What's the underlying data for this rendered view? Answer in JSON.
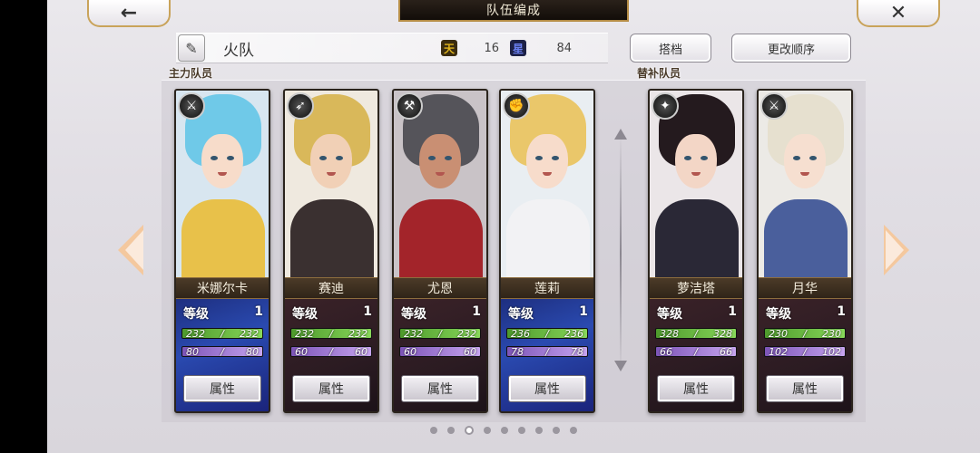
{
  "header": {
    "title": "队伍编成",
    "back_icon": "←",
    "close_icon": "✕"
  },
  "team": {
    "name": "火队",
    "edit_icon": "✎",
    "stat1_icon": "天",
    "stat1_value": "16",
    "stat2_icon": "星",
    "stat2_value": "84"
  },
  "buttons": {
    "partner": "搭档",
    "change_order": "更改顺序"
  },
  "sections": {
    "main": "主力队员",
    "sub": "替补队员"
  },
  "labels": {
    "level": "等级",
    "attr": "属性"
  },
  "cards": [
    {
      "name": "米娜尔卡",
      "level": "1",
      "hp": "232/ 232",
      "hp_cur": "232",
      "hp_max": "232",
      "mp_cur": "80",
      "mp_max": "80",
      "weapon": "⚔",
      "hair": "#6fc9e8",
      "skin": "#f7dcca",
      "cloth": "#e8c14a",
      "bg": "#d8e6f0",
      "stats_bg": "blue"
    },
    {
      "name": "赛迪",
      "level": "1",
      "hp_cur": "232",
      "hp_max": "232",
      "mp_cur": "60",
      "mp_max": "60",
      "weapon": "➶",
      "hair": "#d9b85a",
      "skin": "#f1d0b6",
      "cloth": "#3a3030",
      "bg": "#efe9df",
      "stats_bg": "dark"
    },
    {
      "name": "尤恩",
      "level": "1",
      "hp_cur": "232",
      "hp_max": "232",
      "mp_cur": "60",
      "mp_max": "60",
      "weapon": "⚒",
      "hair": "#55545a",
      "skin": "#c98f73",
      "cloth": "#a3242a",
      "bg": "#c9c3c7",
      "stats_bg": "dark"
    },
    {
      "name": "莲莉",
      "level": "1",
      "hp_cur": "236",
      "hp_max": "236",
      "mp_cur": "78",
      "mp_max": "78",
      "weapon": "✊",
      "hair": "#eac76a",
      "skin": "#f7dccb",
      "cloth": "#f2f2f4",
      "bg": "#e9eef2",
      "stats_bg": "blue"
    },
    {
      "name": "萝洁塔",
      "level": "1",
      "hp_cur": "328",
      "hp_max": "328",
      "mp_cur": "66",
      "mp_max": "66",
      "weapon": "✦",
      "hair": "#241a1e",
      "skin": "#f3d6c6",
      "cloth": "#2a2836",
      "bg": "#ebe6e8",
      "stats_bg": "dark"
    },
    {
      "name": "月华",
      "level": "1",
      "hp_cur": "230",
      "hp_max": "230",
      "mp_cur": "102",
      "mp_max": "102",
      "weapon": "⚔",
      "hair": "#e6e0cf",
      "skin": "#f6dfd0",
      "cloth": "#4a5f9c",
      "bg": "#eceae6",
      "stats_bg": "dark"
    }
  ],
  "pagination": {
    "total": 9,
    "active": 2
  }
}
